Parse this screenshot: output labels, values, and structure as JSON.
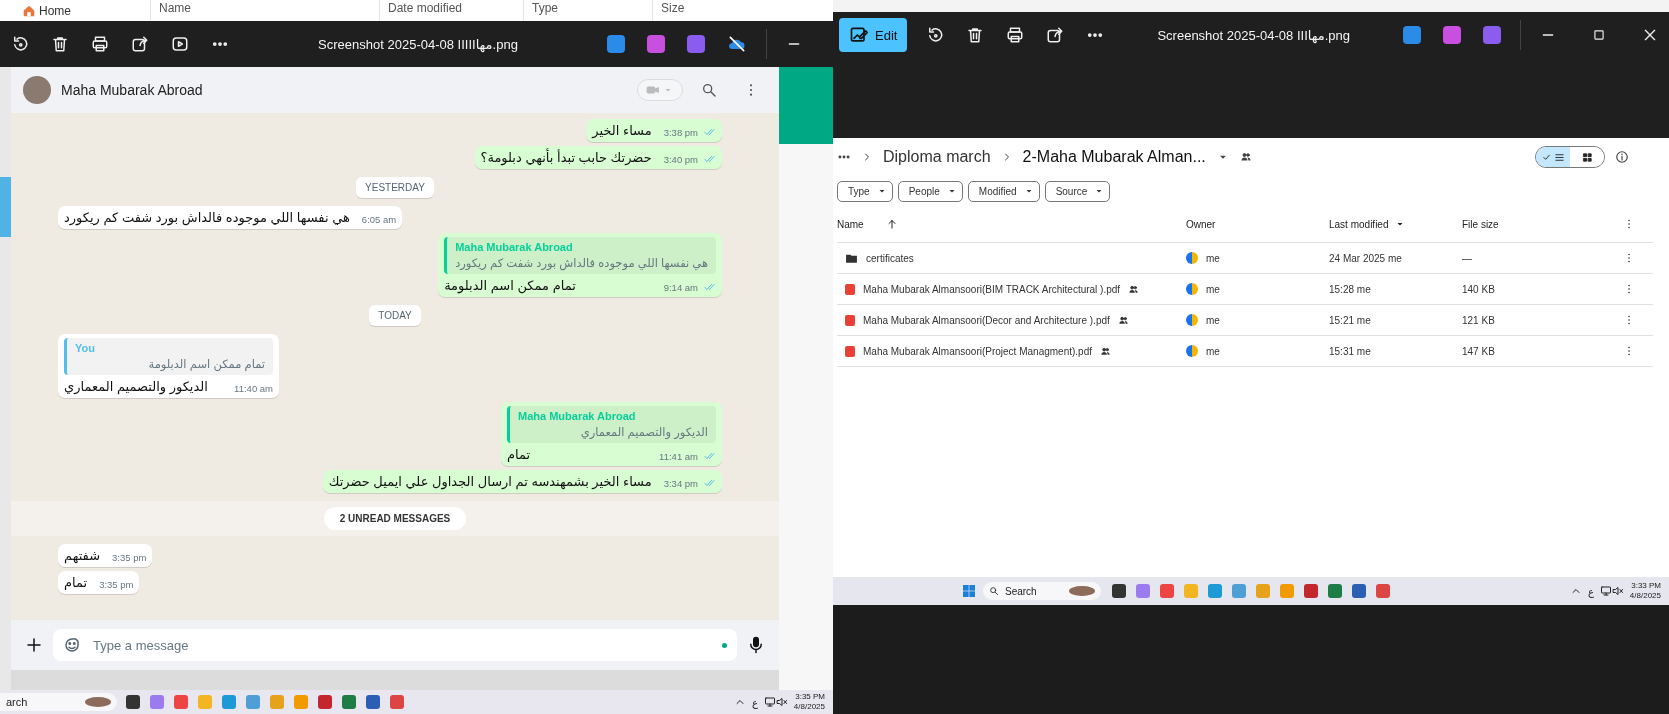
{
  "explorer_header": {
    "home": "Home",
    "columns": [
      "Name",
      "Date modified",
      "Type",
      "Size"
    ]
  },
  "left_viewer": {
    "title": "Screenshot 2025-04-08 IIIIIمها.png"
  },
  "chat": {
    "contact": "Maha Mubarak Abroad",
    "messages": [
      {
        "kind": "out",
        "text": "مساء الخير",
        "time": "3:38 pm"
      },
      {
        "kind": "out",
        "text": "حضرتك حابب تبدأ بأنهي دبلومة؟",
        "time": "3:40 pm"
      },
      {
        "kind": "date",
        "text": "YESTERDAY"
      },
      {
        "kind": "in",
        "text": "هي نفسها اللي موجوده فالداش بورد شفت كم ريكورد",
        "time": "6:05 am"
      },
      {
        "kind": "out",
        "quote": {
          "author": "Maha Mubarak Abroad",
          "text": "هي نفسها اللي موجوده فالداش بورد شفت كم ريكورد"
        },
        "text": "تمام ممكن اسم الدبلومة",
        "time": "9:14 am"
      },
      {
        "kind": "date",
        "text": "TODAY"
      },
      {
        "kind": "in",
        "quote": {
          "author": "You",
          "text": "تمام ممكن اسم الدبلومة"
        },
        "text": "الديكور والتصميم المعماري",
        "time": "11:40 am"
      },
      {
        "kind": "out",
        "quote": {
          "author": "Maha Mubarak Abroad",
          "text": "الديكور والتصميم المعماري"
        },
        "text": "تمام",
        "time": "11:41 am"
      },
      {
        "kind": "out",
        "text": "مساء الخير بشمهندسه تم ارسال الجداول علي ايميل حضرتك",
        "time": "3:34 pm"
      },
      {
        "kind": "unread",
        "text": "2 UNREAD MESSAGES"
      },
      {
        "kind": "in",
        "text": "شفتهم",
        "time": "3:35 pm"
      },
      {
        "kind": "in",
        "text": "تمام",
        "time": "3:35 pm"
      }
    ],
    "composer": {
      "placeholder": "Type a message"
    }
  },
  "left_taskbar": {
    "search": "arch",
    "language": "ع",
    "time": "3:35 PM",
    "date": "4/8/2025"
  },
  "right_viewer": {
    "edit": "Edit",
    "title": "Screenshot 2025-04-08 IIIمها.png"
  },
  "drive": {
    "breadcrumb": [
      "Diploma march",
      "2-Maha Mubarak Alman..."
    ],
    "view_toggle": [
      {
        "kind": "list",
        "selected": true
      },
      {
        "kind": "grid",
        "selected": false
      }
    ],
    "filters": [
      "Type",
      "People",
      "Modified",
      "Source"
    ],
    "columns": [
      "Name",
      "Owner",
      "Last modified",
      "File size"
    ],
    "rows": [
      {
        "kind": "folder",
        "name": "certificates",
        "shared": false,
        "owner": "me",
        "modified": "24 Mar 2025 me",
        "size": "—"
      },
      {
        "kind": "pdf",
        "name": "Maha Mubarak Almansoori(BIM TRACK Architectural ).pdf",
        "shared": true,
        "owner": "me",
        "modified": "15:28 me",
        "size": "140 KB"
      },
      {
        "kind": "pdf",
        "name": "Maha Mubarak Almansoori(Decor and Architecture ).pdf",
        "shared": true,
        "owner": "me",
        "modified": "15:21 me",
        "size": "121 KB"
      },
      {
        "kind": "pdf",
        "name": "Maha Mubarak Almansoori(Project Managment).pdf",
        "shared": true,
        "owner": "me",
        "modified": "15:31 me",
        "size": "147 KB"
      }
    ]
  },
  "right_taskbar": {
    "search": "Search",
    "language": "ع",
    "time": "3:33 PM",
    "date": "4/8/2025"
  }
}
